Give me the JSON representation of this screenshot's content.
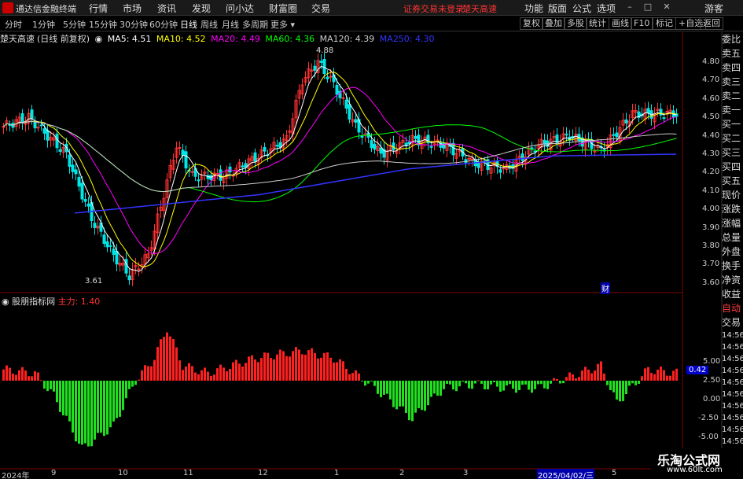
{
  "app": {
    "title": "通达信金融终端"
  },
  "menu": [
    "行情",
    "市场",
    "资讯",
    "发现",
    "问小达",
    "财富圈",
    "交易"
  ],
  "notice": [
    "证券交易未登录",
    "楚天高速"
  ],
  "right_menu": [
    "功能",
    "版面",
    "公式",
    "选项"
  ],
  "user": "游客",
  "periods": [
    "分时",
    "1分钟",
    "5分钟",
    "15分钟",
    "30分钟",
    "60分钟",
    "日线",
    "周线",
    "月线",
    "多周期",
    "更多"
  ],
  "active_period": "日线",
  "tools": [
    "复权",
    "叠加",
    "多股",
    "统计",
    "画线",
    "F10",
    "标记",
    "+自选",
    "返回"
  ],
  "info": {
    "stock": "楚天高速",
    "mode": "(日线 前复权)",
    "ma5": "MA5: 4.51",
    "ma10": "MA10: 4.52",
    "ma20": "MA20: 4.49",
    "ma60": "MA60: 4.36",
    "ma120": "MA120: 4.39",
    "ma250": "MA250: 4.30"
  },
  "colors": {
    "up": "#ff3232",
    "down": "#00e5e5",
    "ma5": "#ffffff",
    "ma10": "#ffff00",
    "ma20": "#ff00ff",
    "ma60": "#00ff00",
    "ma120": "#cccccc",
    "ma250": "#3333ff"
  },
  "price_axis": [
    "4.80",
    "4.70",
    "4.60",
    "4.50",
    "4.40",
    "4.30",
    "4.20",
    "4.10",
    "4.00",
    "3.90",
    "3.80",
    "3.70",
    "3.60"
  ],
  "high_label": "4.88",
  "low_label": "3.61",
  "event_marker": "财",
  "indicator": {
    "name": "股朋指标网",
    "line": "主力: 1.40",
    "current": "0.42"
  },
  "indicator_axis": [
    "5.00",
    "2.50",
    "0.00",
    "-2.50",
    "-5.00"
  ],
  "sidebar": [
    "委比",
    "卖五",
    "卖四",
    "卖三",
    "卖二",
    "卖一",
    "买一",
    "买二",
    "买三",
    "买四",
    "买五",
    "现价",
    "涨跌",
    "涨幅",
    "总量",
    "外盘",
    "换手",
    "净资",
    "收益",
    "自动",
    "交易",
    "14:56",
    "14:56",
    "14:56",
    "14:56",
    "14:56",
    "14:56",
    "14:56",
    "14:56",
    "14:56",
    "14:56"
  ],
  "dates": [
    "2024年",
    "9",
    "10",
    "11",
    "12",
    "1",
    "2",
    "3",
    "2025/04/02/三",
    "5"
  ],
  "watermark": {
    "line1": "乐淘公式网",
    "line2": "www.60lt.com"
  }
}
